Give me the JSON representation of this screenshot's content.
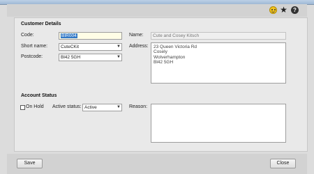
{
  "toolbar": {
    "icons": [
      "smiley-icon",
      "star-icon",
      "help-icon"
    ],
    "help_glyph": "?",
    "star_glyph": "★"
  },
  "customer_details": {
    "heading": "Customer Details",
    "code_label": "Code:",
    "code_value": "BIR004",
    "short_name_label": "Short name:",
    "short_name_value": "CuteCKit",
    "postcode_label": "Postcode:",
    "postcode_value": "Bl42 5GH",
    "name_label": "Name:",
    "name_value": "Cute and Cosey Kitsch",
    "address_label": "Address:",
    "address_lines": [
      "23 Queen Victoria Rd",
      "Cosely",
      "Wolverhampton",
      "Bl42 5GH"
    ]
  },
  "account_status": {
    "heading": "Account Status",
    "on_hold_label": "On Hold",
    "on_hold_checked": false,
    "active_status_label": "Active status:",
    "active_status_value": "Active",
    "reason_label": "Reason:",
    "reason_value": ""
  },
  "footer": {
    "save_label": "Save",
    "close_label": "Close"
  },
  "colors": {
    "selection": "#3178c6",
    "panel": "#e9e9e9",
    "toolbar": "#d2d2d2"
  }
}
